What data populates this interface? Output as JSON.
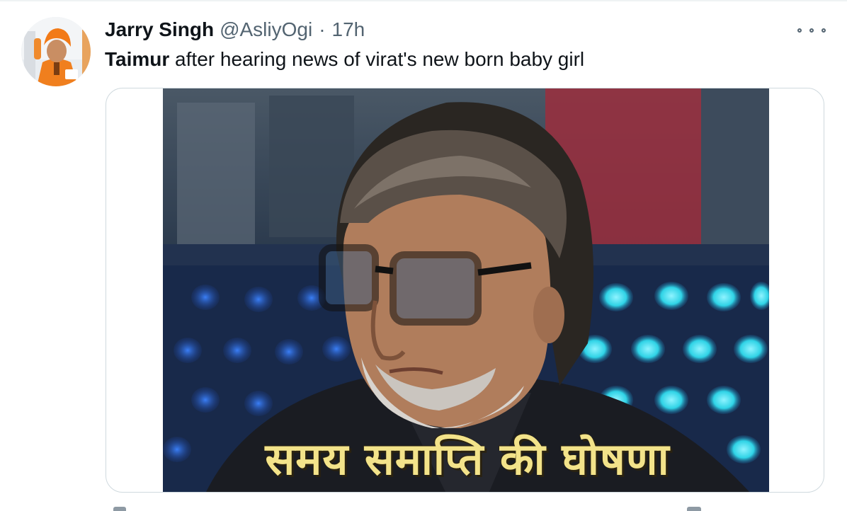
{
  "tweet": {
    "display_name": "Jarry Singh",
    "handle": "@AsliyOgi",
    "separator": "·",
    "time": "17h",
    "text_bold": "Taimur",
    "text_rest": " after hearing news of virat's new born baby girl",
    "media": {
      "caption": "समय समाप्ति की घोषणा"
    }
  },
  "icons": {
    "more": "more-horizontal-icon"
  }
}
